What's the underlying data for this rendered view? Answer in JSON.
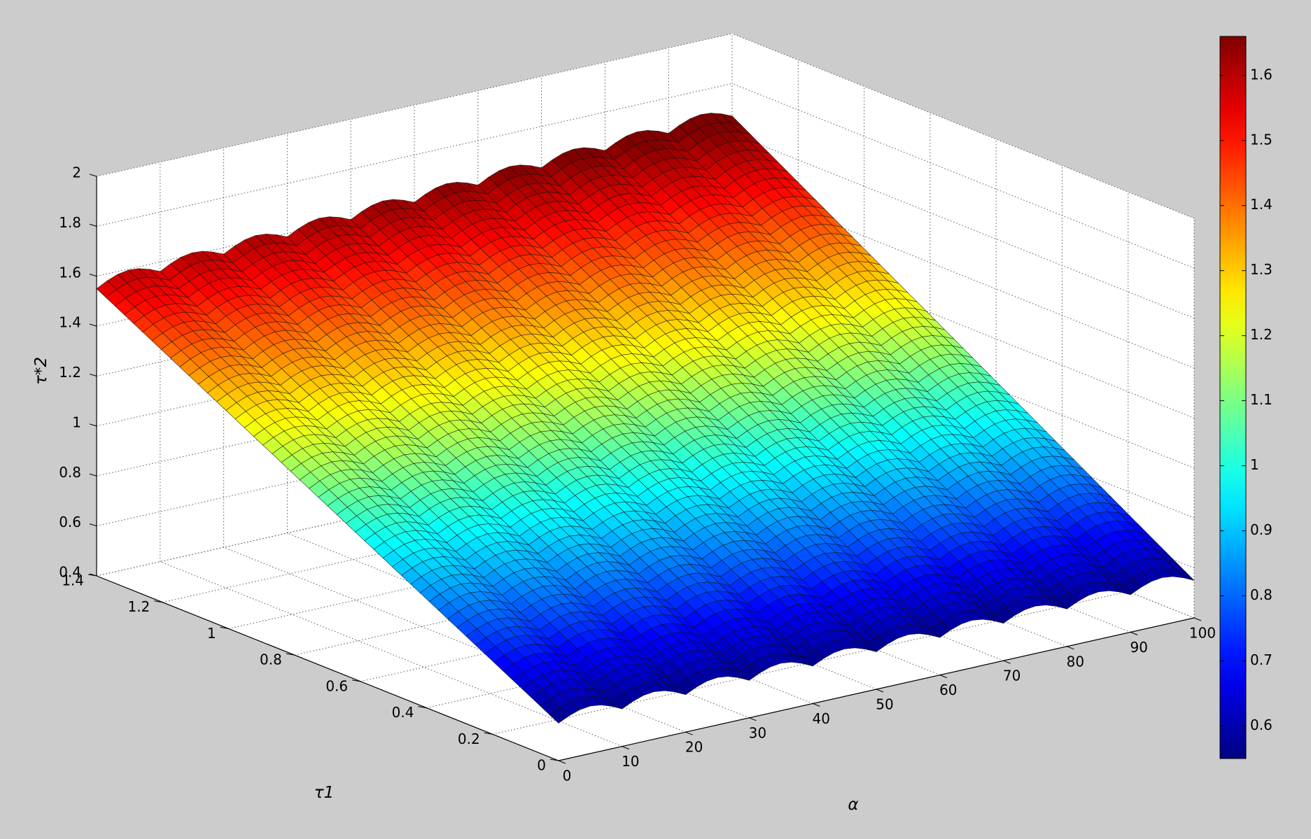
{
  "chart_data": {
    "type": "surface",
    "title": "",
    "colormap": "jet",
    "xlabel": "α",
    "ylabel": "τ1",
    "zlabel": "τ*2",
    "x_range": [
      0,
      100
    ],
    "y_range": [
      0,
      1.4
    ],
    "z_range": [
      0.4,
      2
    ],
    "x_ticks": [
      "0",
      "10",
      "20",
      "30",
      "40",
      "50",
      "60",
      "70",
      "80",
      "90",
      "100"
    ],
    "y_ticks": [
      "0",
      "0.2",
      "0.4",
      "0.6",
      "0.8",
      "1",
      "1.2",
      "1.4"
    ],
    "z_ticks": [
      "0.4",
      "0.6",
      "0.8",
      "1",
      "1.2",
      "1.4",
      "1.6",
      "1.8",
      "2"
    ],
    "grid": true,
    "surface": {
      "corners": [
        {
          "x": 0,
          "y": 0,
          "z": 0.55
        },
        {
          "x": 100,
          "y": 0,
          "z": 0.55
        },
        {
          "x": 0,
          "y": 1.4,
          "z": 1.55
        },
        {
          "x": 100,
          "y": 1.4,
          "z": 1.67
        }
      ],
      "ripple_count_along_alpha": 10,
      "ripple_amplitude": 0.04
    },
    "colorbar": {
      "range": [
        0.55,
        1.66
      ],
      "ticks": [
        "0.6",
        "0.7",
        "0.8",
        "0.9",
        "1",
        "1.1",
        "1.2",
        "1.3",
        "1.4",
        "1.5",
        "1.6"
      ]
    }
  }
}
